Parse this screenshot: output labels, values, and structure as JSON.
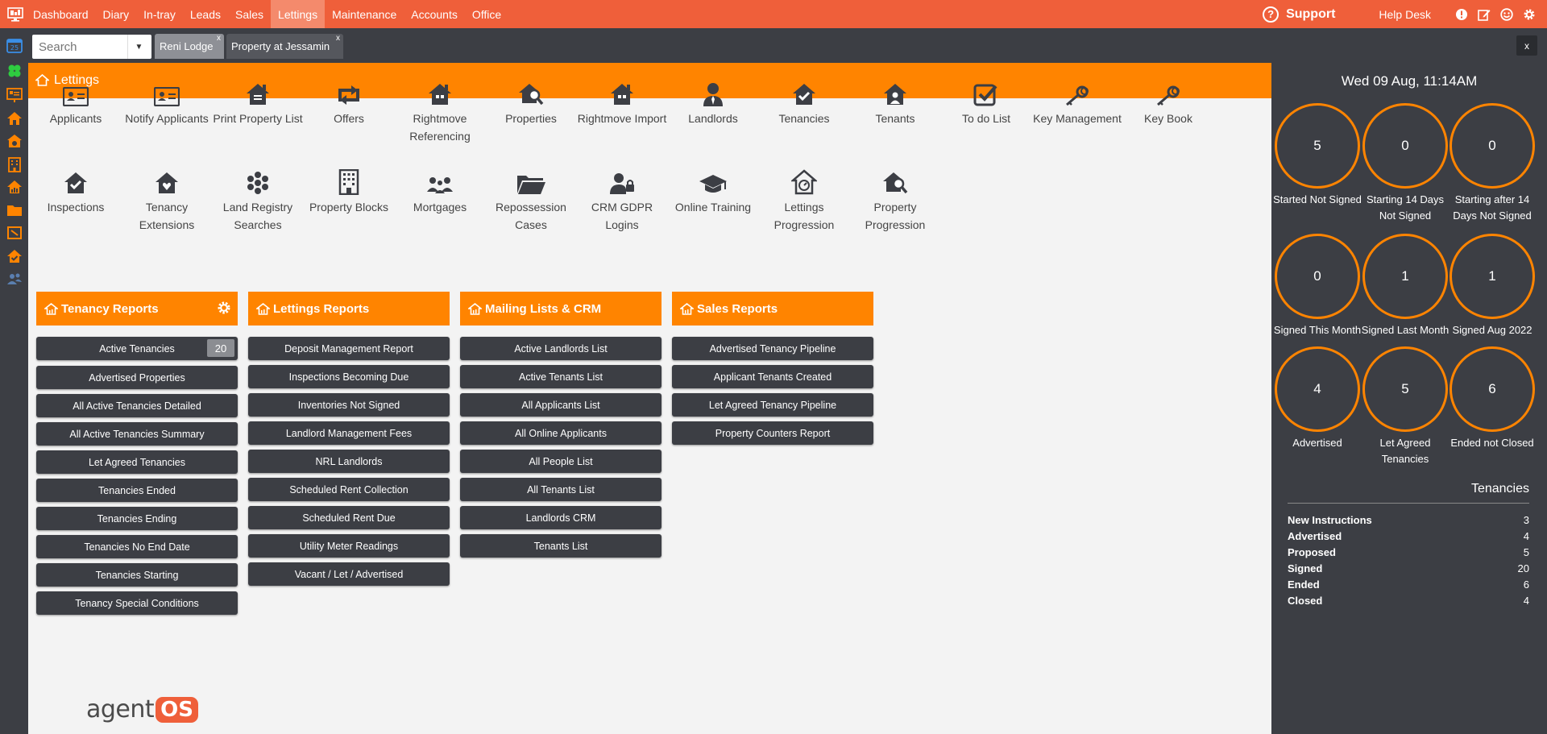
{
  "topnav": {
    "items": [
      "Dashboard",
      "Diary",
      "In-tray",
      "Leads",
      "Sales",
      "Lettings",
      "Maintenance",
      "Accounts",
      "Office"
    ],
    "active": "Lettings",
    "support": "Support",
    "helpdesk": "Help Desk"
  },
  "tabbar": {
    "search_placeholder": "Search",
    "tabs": [
      {
        "label": "Reni Lodge",
        "close": "x"
      },
      {
        "label": "Property at Jessamin",
        "close": "x"
      }
    ],
    "close_all": "x"
  },
  "main": {
    "title": "Lettings",
    "tiles_row1": [
      {
        "label": "Applicants",
        "icon": "id-card-icon"
      },
      {
        "label": "Notify Applicants",
        "icon": "id-card-icon"
      },
      {
        "label": "Print Property List",
        "icon": "house-list-icon"
      },
      {
        "label": "Offers",
        "icon": "retweet-icon"
      },
      {
        "label": "Rightmove Referencing",
        "icon": "house-icon"
      },
      {
        "label": "Properties",
        "icon": "house-search-icon"
      },
      {
        "label": "Rightmove Import",
        "icon": "house-icon"
      },
      {
        "label": "Landlords",
        "icon": "person-tie-icon"
      },
      {
        "label": "Tenancies",
        "icon": "house-check-icon"
      },
      {
        "label": "Tenants",
        "icon": "house-user-icon"
      },
      {
        "label": "To do List",
        "icon": "checkbox-icon"
      },
      {
        "label": "Key Management",
        "icon": "key-icon"
      },
      {
        "label": "Key Book",
        "icon": "key-icon"
      }
    ],
    "tiles_row2": [
      {
        "label": "Inspections",
        "icon": "house-check-icon"
      },
      {
        "label": "Tenancy Extensions",
        "icon": "house-heart-icon"
      },
      {
        "label": "Land Registry Searches",
        "icon": "flower-icon"
      },
      {
        "label": "Property Blocks",
        "icon": "building-icon"
      },
      {
        "label": "Mortgages",
        "icon": "people-icon"
      },
      {
        "label": "Repossession Cases",
        "icon": "folder-icon"
      },
      {
        "label": "CRM GDPR Logins",
        "icon": "user-lock-icon"
      },
      {
        "label": "Online Training",
        "icon": "graduation-cap-icon"
      },
      {
        "label": "Lettings Progression",
        "icon": "house-gauge-icon"
      },
      {
        "label": "Property Progression",
        "icon": "house-search-icon"
      }
    ],
    "panels": [
      {
        "title": "Tenancy Reports",
        "items": [
          "Active Tenancies",
          "Advertised Properties",
          "All Active Tenancies Detailed",
          "All Active Tenancies Summary",
          "Let Agreed Tenancies",
          "Tenancies Ended",
          "Tenancies Ending",
          "Tenancies No End Date",
          "Tenancies Starting",
          "Tenancy Special Conditions"
        ],
        "count": "20"
      },
      {
        "title": "Lettings Reports",
        "items": [
          "Deposit Management Report",
          "Inspections Becoming Due",
          "Inventories Not Signed",
          "Landlord Management Fees",
          "NRL Landlords",
          "Scheduled Rent Collection",
          "Scheduled Rent Due",
          "Utility Meter Readings",
          "Vacant / Let / Advertised"
        ]
      },
      {
        "title": "Mailing Lists & CRM",
        "items": [
          "Active Landlords List",
          "Active Tenants List",
          "All Applicants List",
          "All Online Applicants",
          "All People List",
          "All Tenants List",
          "Landlords CRM",
          "Tenants List"
        ]
      },
      {
        "title": "Sales Reports",
        "items": [
          "Advertised Tenancy Pipeline",
          "Applicant Tenants Created",
          "Let Agreed Tenancy Pipeline",
          "Property Counters Report"
        ]
      }
    ],
    "brand": {
      "agent": "agent",
      "os": "OS"
    }
  },
  "dashboard": {
    "datetime": "Wed 09 Aug, 11:14AM",
    "circles": [
      {
        "value": "5",
        "label": "Started Not Signed"
      },
      {
        "value": "0",
        "label": "Starting 14 Days Not Signed"
      },
      {
        "value": "0",
        "label": "Starting after 14 Days Not Signed"
      },
      {
        "value": "0",
        "label": "Signed This Month"
      },
      {
        "value": "1",
        "label": "Signed Last Month"
      },
      {
        "value": "1",
        "label": "Signed Aug 2022"
      },
      {
        "value": "4",
        "label": "Advertised"
      },
      {
        "value": "5",
        "label": "Let Agreed Tenancies"
      },
      {
        "value": "6",
        "label": "Ended not Closed"
      }
    ],
    "tenancies_title": "Tenancies",
    "tenancies": [
      {
        "label": "New Instructions",
        "value": "3"
      },
      {
        "label": "Advertised",
        "value": "4"
      },
      {
        "label": "Proposed",
        "value": "5"
      },
      {
        "label": "Signed",
        "value": "20"
      },
      {
        "label": "Ended",
        "value": "6"
      },
      {
        "label": "Closed",
        "value": "4"
      }
    ]
  },
  "colors": {
    "brand": "#ef5f3a",
    "accent": "#ff8400",
    "dark": "#3c3e44"
  }
}
